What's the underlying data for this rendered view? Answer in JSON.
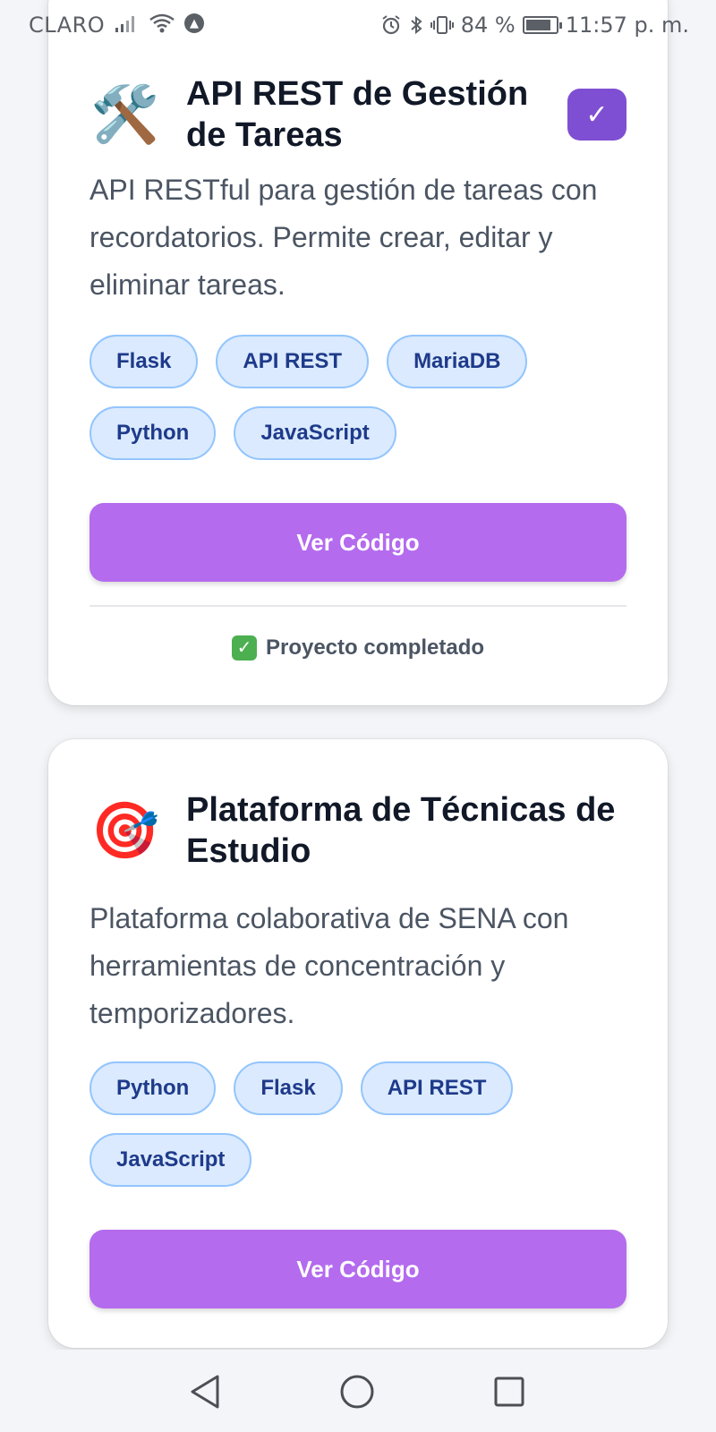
{
  "status_bar": {
    "carrier": "CLARO",
    "battery": "84 %",
    "battery_level": 0.84,
    "time": "11:57 p. m."
  },
  "projects": [
    {
      "icon": "hammer-and-wrench-icon",
      "emoji": "🛠️",
      "title": "API REST de Gestión de Tareas",
      "completed_badge": "✓",
      "description": "API RESTful para gestión de tareas con recordatorios. Permite crear, editar y eliminar tareas.",
      "tags": [
        "Flask",
        "API REST",
        "MariaDB",
        "Python",
        "JavaScript"
      ],
      "button_label": "Ver Código",
      "status_text": "Proyecto completado"
    },
    {
      "icon": "target-icon",
      "emoji": "🎯",
      "title": "Plataforma de Técnicas de Estudio",
      "description": "Plataforma colaborativa de SENA con herramientas de concentración y temporizadores.",
      "tags": [
        "Python",
        "Flask",
        "API REST",
        "JavaScript"
      ],
      "button_label": "Ver Código"
    }
  ],
  "colors": {
    "accent_button": "#b46bee",
    "badge": "#7f4fd3",
    "tag_bg": "#dbeafe",
    "tag_text": "#1e3a8a"
  }
}
